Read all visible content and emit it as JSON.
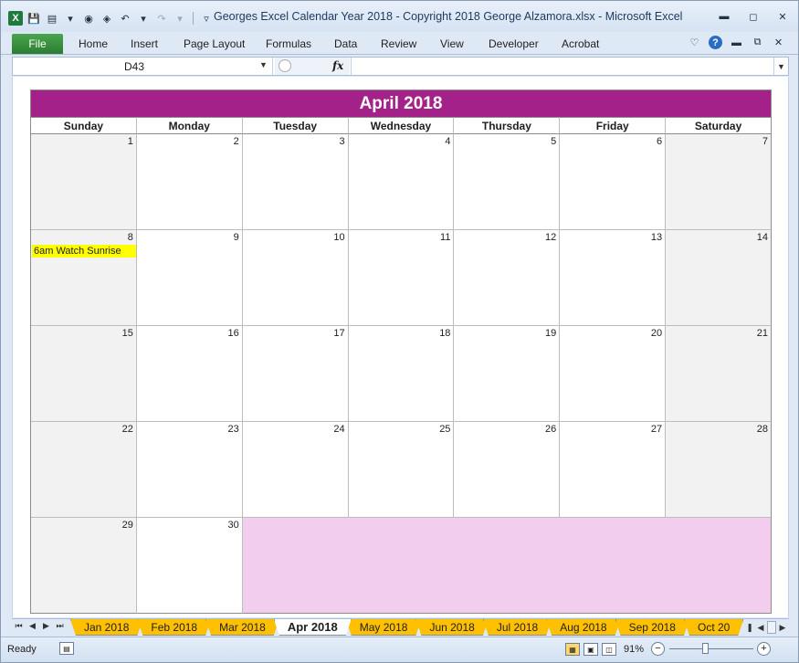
{
  "window": {
    "title": "Georges Excel Calendar Year 2018  -  Copyright 2018 George Alzamora.xlsx  -  Microsoft Excel"
  },
  "qat": {
    "icons": [
      "excel-logo-icon",
      "save-icon",
      "form-icon",
      "find-icon",
      "find-replace-icon",
      "undo-icon",
      "redo-icon",
      "customize-icon"
    ]
  },
  "ribbon": {
    "file_label": "File",
    "tabs": [
      "Home",
      "Insert",
      "Page Layout",
      "Formulas",
      "Data",
      "Review",
      "View",
      "Developer",
      "Acrobat"
    ]
  },
  "formula_bar": {
    "name_box": "D43",
    "fx_label": "fx",
    "formula_value": ""
  },
  "calendar": {
    "title": "April 2018",
    "day_names": [
      "Sunday",
      "Monday",
      "Tuesday",
      "Wednesday",
      "Thursday",
      "Friday",
      "Saturday"
    ],
    "weeks": [
      [
        "1",
        "2",
        "3",
        "4",
        "5",
        "6",
        "7"
      ],
      [
        "8",
        "9",
        "10",
        "11",
        "12",
        "13",
        "14"
      ],
      [
        "15",
        "16",
        "17",
        "18",
        "19",
        "20",
        "21"
      ],
      [
        "22",
        "23",
        "24",
        "25",
        "26",
        "27",
        "28"
      ],
      [
        "29",
        "30"
      ]
    ],
    "event_text": "6am Watch Sunrise",
    "event_highlight_color": "#ffff00",
    "title_color": "#a5218a",
    "filler_color": "#f3cdee"
  },
  "sheet_tabs": {
    "tabs": [
      "Jan 2018",
      "Feb 2018",
      "Mar 2018",
      "Apr 2018",
      "May 2018",
      "Jun 2018",
      "Jul 2018",
      "Aug 2018",
      "Sep 2018",
      "Oct 20"
    ],
    "active": "Apr 2018",
    "tab_color": "#ffc000"
  },
  "status": {
    "ready": "Ready",
    "zoom": "91%",
    "zoom_level_percent": 91
  }
}
